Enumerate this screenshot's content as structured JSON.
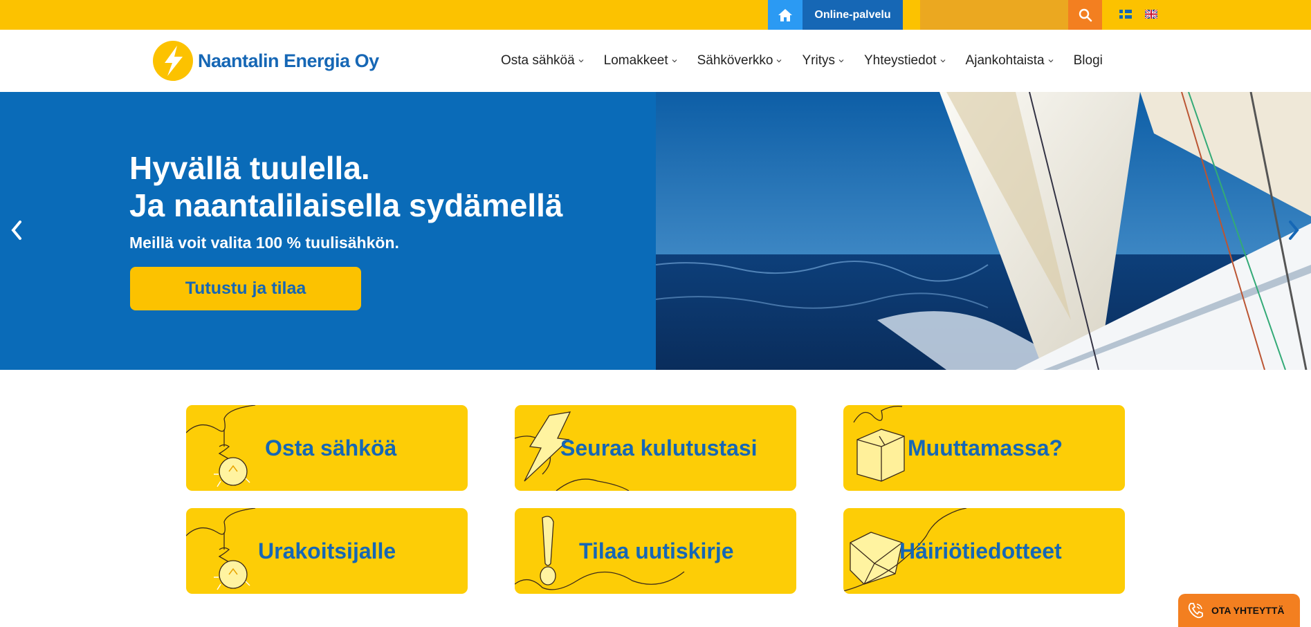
{
  "topbar": {
    "online_label": "Online-palvelu",
    "icons": {
      "home": "home-icon",
      "search": "search-icon",
      "swedish": "flag-sweden-icon",
      "english": "flag-uk-icon"
    }
  },
  "brand": {
    "name": "Naantalin Energia Oy",
    "colors": {
      "yellow": "#fcc200",
      "blue": "#1667b5",
      "orange": "#f37f20",
      "hero_blue": "#0a6bb8"
    }
  },
  "nav": {
    "items": [
      {
        "label": "Osta sähköä",
        "dropdown": true
      },
      {
        "label": "Lomakkeet",
        "dropdown": true
      },
      {
        "label": "Sähköverkko",
        "dropdown": true
      },
      {
        "label": "Yritys",
        "dropdown": true
      },
      {
        "label": "Yhteystiedot",
        "dropdown": true
      },
      {
        "label": "Ajankohtaista",
        "dropdown": true
      },
      {
        "label": "Blogi",
        "dropdown": false
      }
    ]
  },
  "hero": {
    "title_line1": "Hyvällä tuulella.",
    "title_line2": "Ja naantalilaisella sydämellä",
    "subtitle": "Meillä voit valita 100 % tuulisähkön.",
    "cta": "Tutustu ja tilaa"
  },
  "tiles": [
    {
      "label": "Osta sähköä",
      "icon": "lightbulb-icon"
    },
    {
      "label": "Seuraa kulutustasi",
      "icon": "lightning-bolt-icon"
    },
    {
      "label": "Muuttamassa?",
      "icon": "moving-box-icon"
    },
    {
      "label": "Urakoitsijalle",
      "icon": "lightbulb-icon"
    },
    {
      "label": "Tilaa uutiskirje",
      "icon": "exclamation-icon"
    },
    {
      "label": "Häiriötiedotteet",
      "icon": "envelope-icon"
    }
  ],
  "contact": {
    "label": "OTA YHTEYTTÄ",
    "icon": "phone-icon"
  }
}
